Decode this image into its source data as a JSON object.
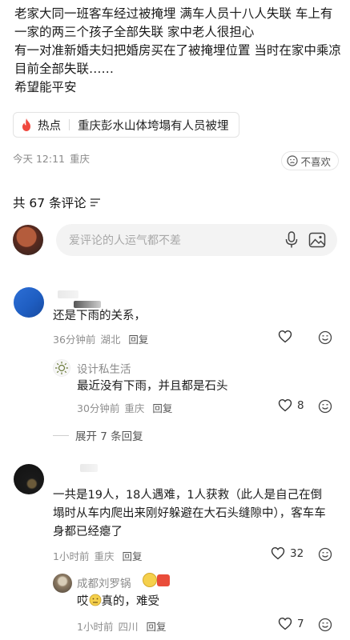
{
  "post": {
    "lines": [
      "老家大同一班客车经过被掩埋 满车人员十八人失联 车上有一家的两三个孩子全部失联 家中老人很担心",
      "有一对准新婚夫妇把婚房买在了被掩埋位置 当时在家中乘凉目前全部失联……",
      "希望能平安"
    ]
  },
  "hot_tag": {
    "icon": "fire-icon",
    "label": "热点",
    "title": "重庆彭水山体垮塌有人员被埋"
  },
  "post_meta": {
    "time": "今天 12:11",
    "location": "重庆",
    "dislike": "不喜欢"
  },
  "comments_header": {
    "count_text": "共 67 条评论"
  },
  "input": {
    "placeholder": "爱评论的人运气都不差"
  },
  "comments": [
    {
      "text": "还是下雨的关系，",
      "time": "36分钟前",
      "location": "湖北",
      "reply": "回复",
      "likes": "",
      "sub": {
        "name": "设计私生活",
        "text": "最近没有下雨，并且都是石头",
        "time": "30分钟前",
        "location": "重庆",
        "reply": "回复",
        "likes": "8"
      },
      "expand": "展开 7 条回复"
    },
    {
      "text": "一共是19人，18人遇难，1人获救（此人是自己在倒塌时从车内爬出来刚好躲避在大石头缝隙中），客车车身都已经瘪了",
      "time": "1小时前",
      "location": "重庆",
      "reply": "回复",
      "likes": "32",
      "sub": {
        "name": "成都刘罗锅",
        "text_before": "哎",
        "text_after": "真的，难受",
        "time": "1小时前",
        "location": "四川",
        "reply": "回复",
        "likes": "7"
      }
    }
  ]
}
